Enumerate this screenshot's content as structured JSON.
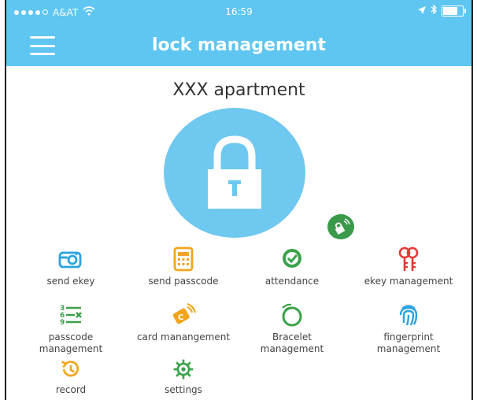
{
  "status_bar": {
    "carrier": "A&AT",
    "time": "16:59"
  },
  "header": {
    "title": "lock management"
  },
  "lock": {
    "name": "XXX apartment"
  },
  "features": [
    {
      "label": "send ekey",
      "icon": "ekey-icon",
      "color": "#2aa4e0"
    },
    {
      "label": "send passcode",
      "icon": "passcode-keypad-icon",
      "color": "#f2a51a"
    },
    {
      "label": "attendance",
      "icon": "attendance-check-icon",
      "color": "#3aa24a"
    },
    {
      "label": "ekey management",
      "icon": "keys-icon",
      "color": "#e53935"
    },
    {
      "label": "passcode management",
      "icon": "passcode-list-icon",
      "color": "#3aa24a"
    },
    {
      "label": "card manangement",
      "icon": "card-icon",
      "color": "#f2a51a"
    },
    {
      "label": "Bracelet management",
      "icon": "bracelet-icon",
      "color": "#3aa24a"
    },
    {
      "label": "fingerprint management",
      "icon": "fingerprint-icon",
      "color": "#2aa4e0"
    },
    {
      "label": "record",
      "icon": "record-history-icon",
      "color": "#f2a51a"
    },
    {
      "label": "settings",
      "icon": "gear-icon",
      "color": "#3aa24a"
    }
  ],
  "colors": {
    "primary": "#5ec6f1",
    "lock_circle": "#6fc8f0",
    "badge": "#3a9a4a"
  }
}
